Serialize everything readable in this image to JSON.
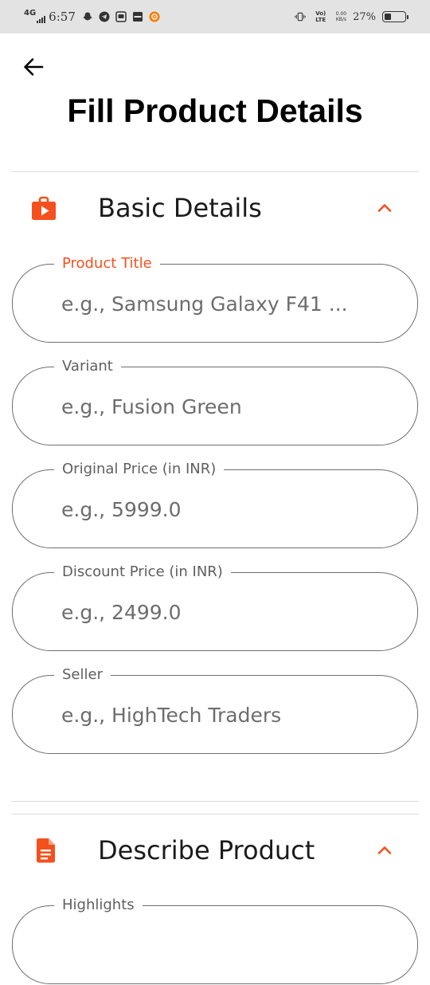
{
  "status_bar": {
    "network": "4G",
    "time": "6:57",
    "volte": "Vo) LTE",
    "speed_value": "0.00",
    "speed_unit": "KB/s",
    "battery": "27%",
    "battery_level": 0.27,
    "icons": [
      "snapchat-icon",
      "telegram-icon",
      "messaging-icon",
      "media-icon",
      "app-notification-icon",
      "vibrate-icon"
    ]
  },
  "header": {
    "title": "Fill Product Details"
  },
  "colors": {
    "accent": "#f4511e",
    "border": "#6e6e6e",
    "status_bar_bg": "#e3e3e3"
  },
  "sections": [
    {
      "title": "Basic Details",
      "icon": "shopping-bag-play-icon",
      "expanded": true,
      "fields": [
        {
          "label": "Product Title",
          "placeholder": "e.g., Samsung Galaxy F41 ...",
          "value": "",
          "focused": true
        },
        {
          "label": "Variant",
          "placeholder": "e.g., Fusion Green",
          "value": ""
        },
        {
          "label": "Original Price (in INR)",
          "placeholder": "e.g., 5999.0",
          "value": ""
        },
        {
          "label": "Discount Price (in INR)",
          "placeholder": "e.g., 2499.0",
          "value": ""
        },
        {
          "label": "Seller",
          "placeholder": "e.g., HighTech Traders",
          "value": ""
        }
      ]
    },
    {
      "title": "Describe Product",
      "icon": "document-icon",
      "expanded": true,
      "fields": [
        {
          "label": "Highlights",
          "placeholder": "",
          "value": ""
        }
      ]
    }
  ]
}
